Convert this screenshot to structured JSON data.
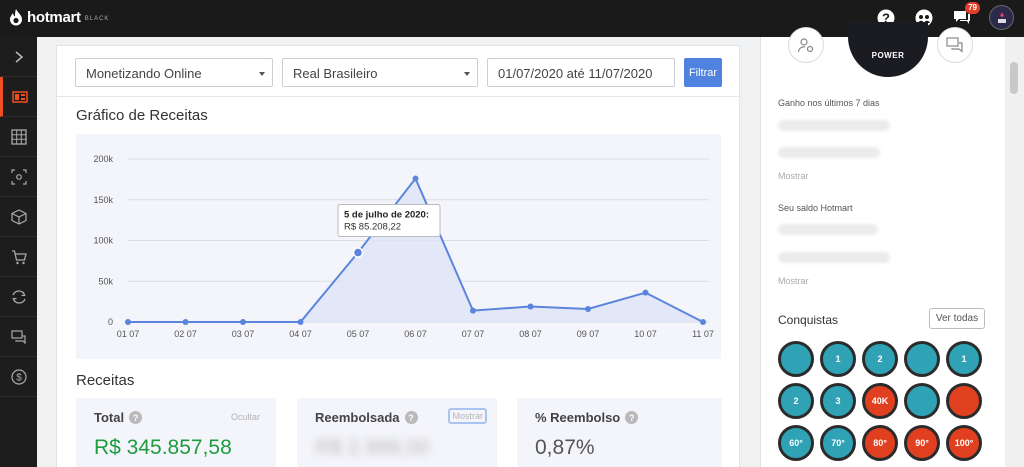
{
  "app": {
    "name": "hotmart",
    "tier": "BLACK",
    "notifications_count": "79"
  },
  "filters": {
    "product": "Monetizando Online",
    "currency": "Real Brasileiro",
    "date_range": "01/07/2020 até 11/07/2020",
    "filter_label": "Filtrar"
  },
  "chart_section": {
    "title": "Gráfico de Receitas"
  },
  "chart_data": {
    "type": "area",
    "title": "Gráfico de Receitas",
    "categories": [
      "01 07",
      "02 07",
      "03 07",
      "04 07",
      "05 07",
      "06 07",
      "07 07",
      "08 07",
      "09 07",
      "10 07",
      "11 07"
    ],
    "values": [
      0,
      0,
      0,
      0,
      85208.22,
      176000,
      14000,
      19000,
      16000,
      36000,
      0
    ],
    "y_ticks": [
      "0",
      "50k",
      "100k",
      "150k",
      "200k"
    ],
    "ylim": [
      0,
      200000
    ],
    "grid": true,
    "tooltip": {
      "index": 4,
      "title": "5 de julho de 2020:",
      "value": "R$ 85.208,22"
    },
    "colors": {
      "line": "#5b84dd",
      "area": "#dfe5f7"
    }
  },
  "revenue": {
    "title": "Receitas",
    "total": {
      "label": "Total",
      "action": "Ocultar",
      "value": "R$ 345.857,58",
      "color": "#1e9c3f"
    },
    "refunded": {
      "label": "Reembolsada",
      "action": "Mostrar",
      "value": "R$ 2.999,00"
    },
    "refund_pct": {
      "label": "% Reembolso",
      "value": "0,87%"
    }
  },
  "right_panel": {
    "power_label": "POWER",
    "earned_label": "Ganho nos últimos 7 dias",
    "earned_show": "Mostrar",
    "balance_label": "Seu saldo Hotmart",
    "balance_show": "Mostrar",
    "achievements_title": "Conquistas",
    "see_all": "Ver todas",
    "badges": [
      {
        "text": "",
        "color": "#2fa3b5"
      },
      {
        "text": "1",
        "color": "#2fa3b5"
      },
      {
        "text": "2",
        "color": "#2fa3b5"
      },
      {
        "text": "",
        "color": "#2fa3b5"
      },
      {
        "text": "1",
        "color": "#2fa3b5"
      },
      {
        "text": "2",
        "color": "#2fa3b5"
      },
      {
        "text": "3",
        "color": "#2fa3b5"
      },
      {
        "text": "40K",
        "color": "#e0401f"
      },
      {
        "text": "",
        "color": "#2fa3b5"
      },
      {
        "text": "",
        "color": "#e0401f"
      },
      {
        "text": "60°",
        "color": "#2fa3b5"
      },
      {
        "text": "70°",
        "color": "#2fa3b5"
      },
      {
        "text": "80°",
        "color": "#e0401f"
      },
      {
        "text": "90°",
        "color": "#e0401f"
      },
      {
        "text": "100°",
        "color": "#e0401f"
      }
    ]
  }
}
